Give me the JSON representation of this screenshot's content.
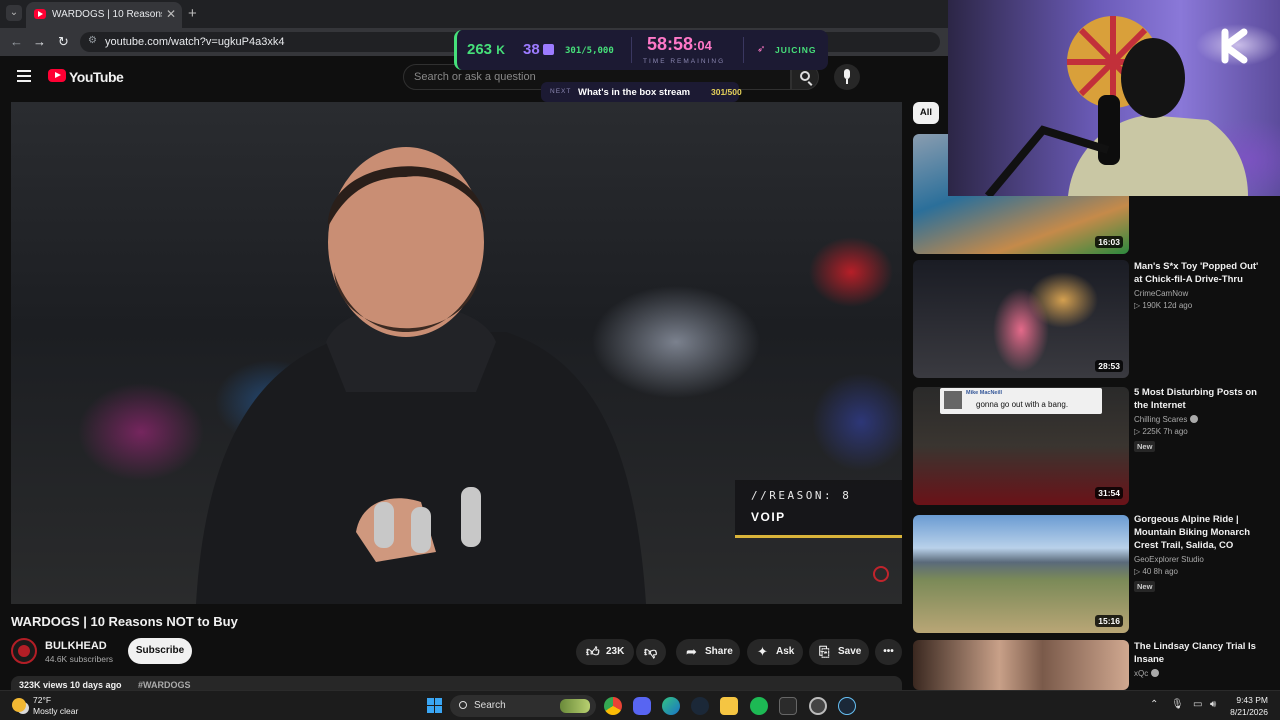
{
  "browser": {
    "tab_title": "WARDOGS | 10 Reasons NOT to Buy",
    "tab_close": "✕",
    "new_tab": "+",
    "url": "youtube.com/watch?v=ugkuP4a3xk4"
  },
  "youtube": {
    "logo_text": "YouTube",
    "search_placeholder": "Search or ask a question"
  },
  "overlay": {
    "stat1": "263",
    "stat1_unit": "K",
    "stat2": "38",
    "progress": "301/5,000",
    "timer": "58:58",
    "timer_seconds": ":04",
    "timer_label": "TIME REMAINING",
    "status": "JUICING",
    "next_label": "NEXT",
    "next_text": "What's in the box stream",
    "next_count": "301/500",
    "accent_green": "#46e07a",
    "accent_pink": "#ff78c8",
    "accent_purple": "#9c7bff"
  },
  "video": {
    "overlay_line1": "//REASON: 8",
    "overlay_line2": "VOIP",
    "title": "WARDOGS | 10 Reasons NOT to Buy",
    "channel": "BULKHEAD",
    "subscribers": "44.6K subscribers",
    "subscribe_label": "Subscribe",
    "likes": "23K",
    "share_label": "Share",
    "ask_label": "Ask",
    "save_label": "Save",
    "stats": "323K views  10 days ago",
    "hashtag": "#WARDOGS"
  },
  "sidebar": {
    "chip_all": "All",
    "items": [
      {
        "title": "",
        "channel": "",
        "meta": "",
        "duration": "16:03",
        "badge": ""
      },
      {
        "title": "Man's S*x Toy 'Popped Out' at Chick-fil-A Drive-Thru",
        "channel": "CrimeCamNow",
        "meta": "▷ 190K  12d ago",
        "duration": "28:53",
        "badge": ""
      },
      {
        "title": "5 Most Disturbing Posts on the Internet",
        "channel": "Chilling Scares",
        "meta": "▷ 225K  7h ago",
        "duration": "31:54",
        "badge": "New"
      },
      {
        "title": "Gorgeous Alpine Ride | Mountain Biking Monarch Crest Trail, Salida, CO",
        "channel": "GeoExplorer Studio",
        "meta": "▷ 40  8h ago",
        "duration": "15:16",
        "badge": "New"
      },
      {
        "title": "The Lindsay Clancy Trial Is Insane",
        "channel": "xQc",
        "meta": "",
        "duration": "",
        "badge": ""
      }
    ],
    "thumb2_caption_name": "Mike MacNeill",
    "thumb2_caption_text": "gonna go out with a bang."
  },
  "taskbar": {
    "temperature": "72°F",
    "weather": "Mostly clear",
    "search_label": "Search",
    "time": "9:43 PM",
    "date": "8/21/2026"
  }
}
